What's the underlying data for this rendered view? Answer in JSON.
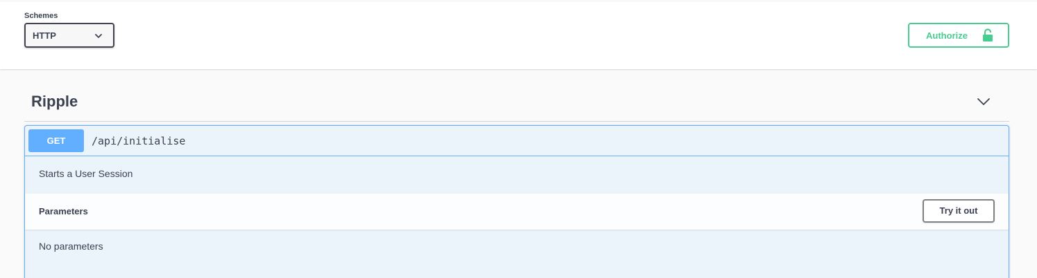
{
  "schemes": {
    "label": "Schemes",
    "selected": "HTTP",
    "icon": "chevron-down-icon"
  },
  "authorize": {
    "label": "Authorize",
    "icon": "unlocked-lock-icon",
    "color": "#49cc90"
  },
  "tag": {
    "title": "Ripple",
    "toggle_icon": "chevron-down-icon"
  },
  "operation": {
    "method": "GET",
    "method_color": "#61affe",
    "path": "/api/initialise",
    "description": "Starts a User Session",
    "parameters_title": "Parameters",
    "try_it_out_label": "Try it out",
    "no_parameters_text": "No parameters"
  }
}
